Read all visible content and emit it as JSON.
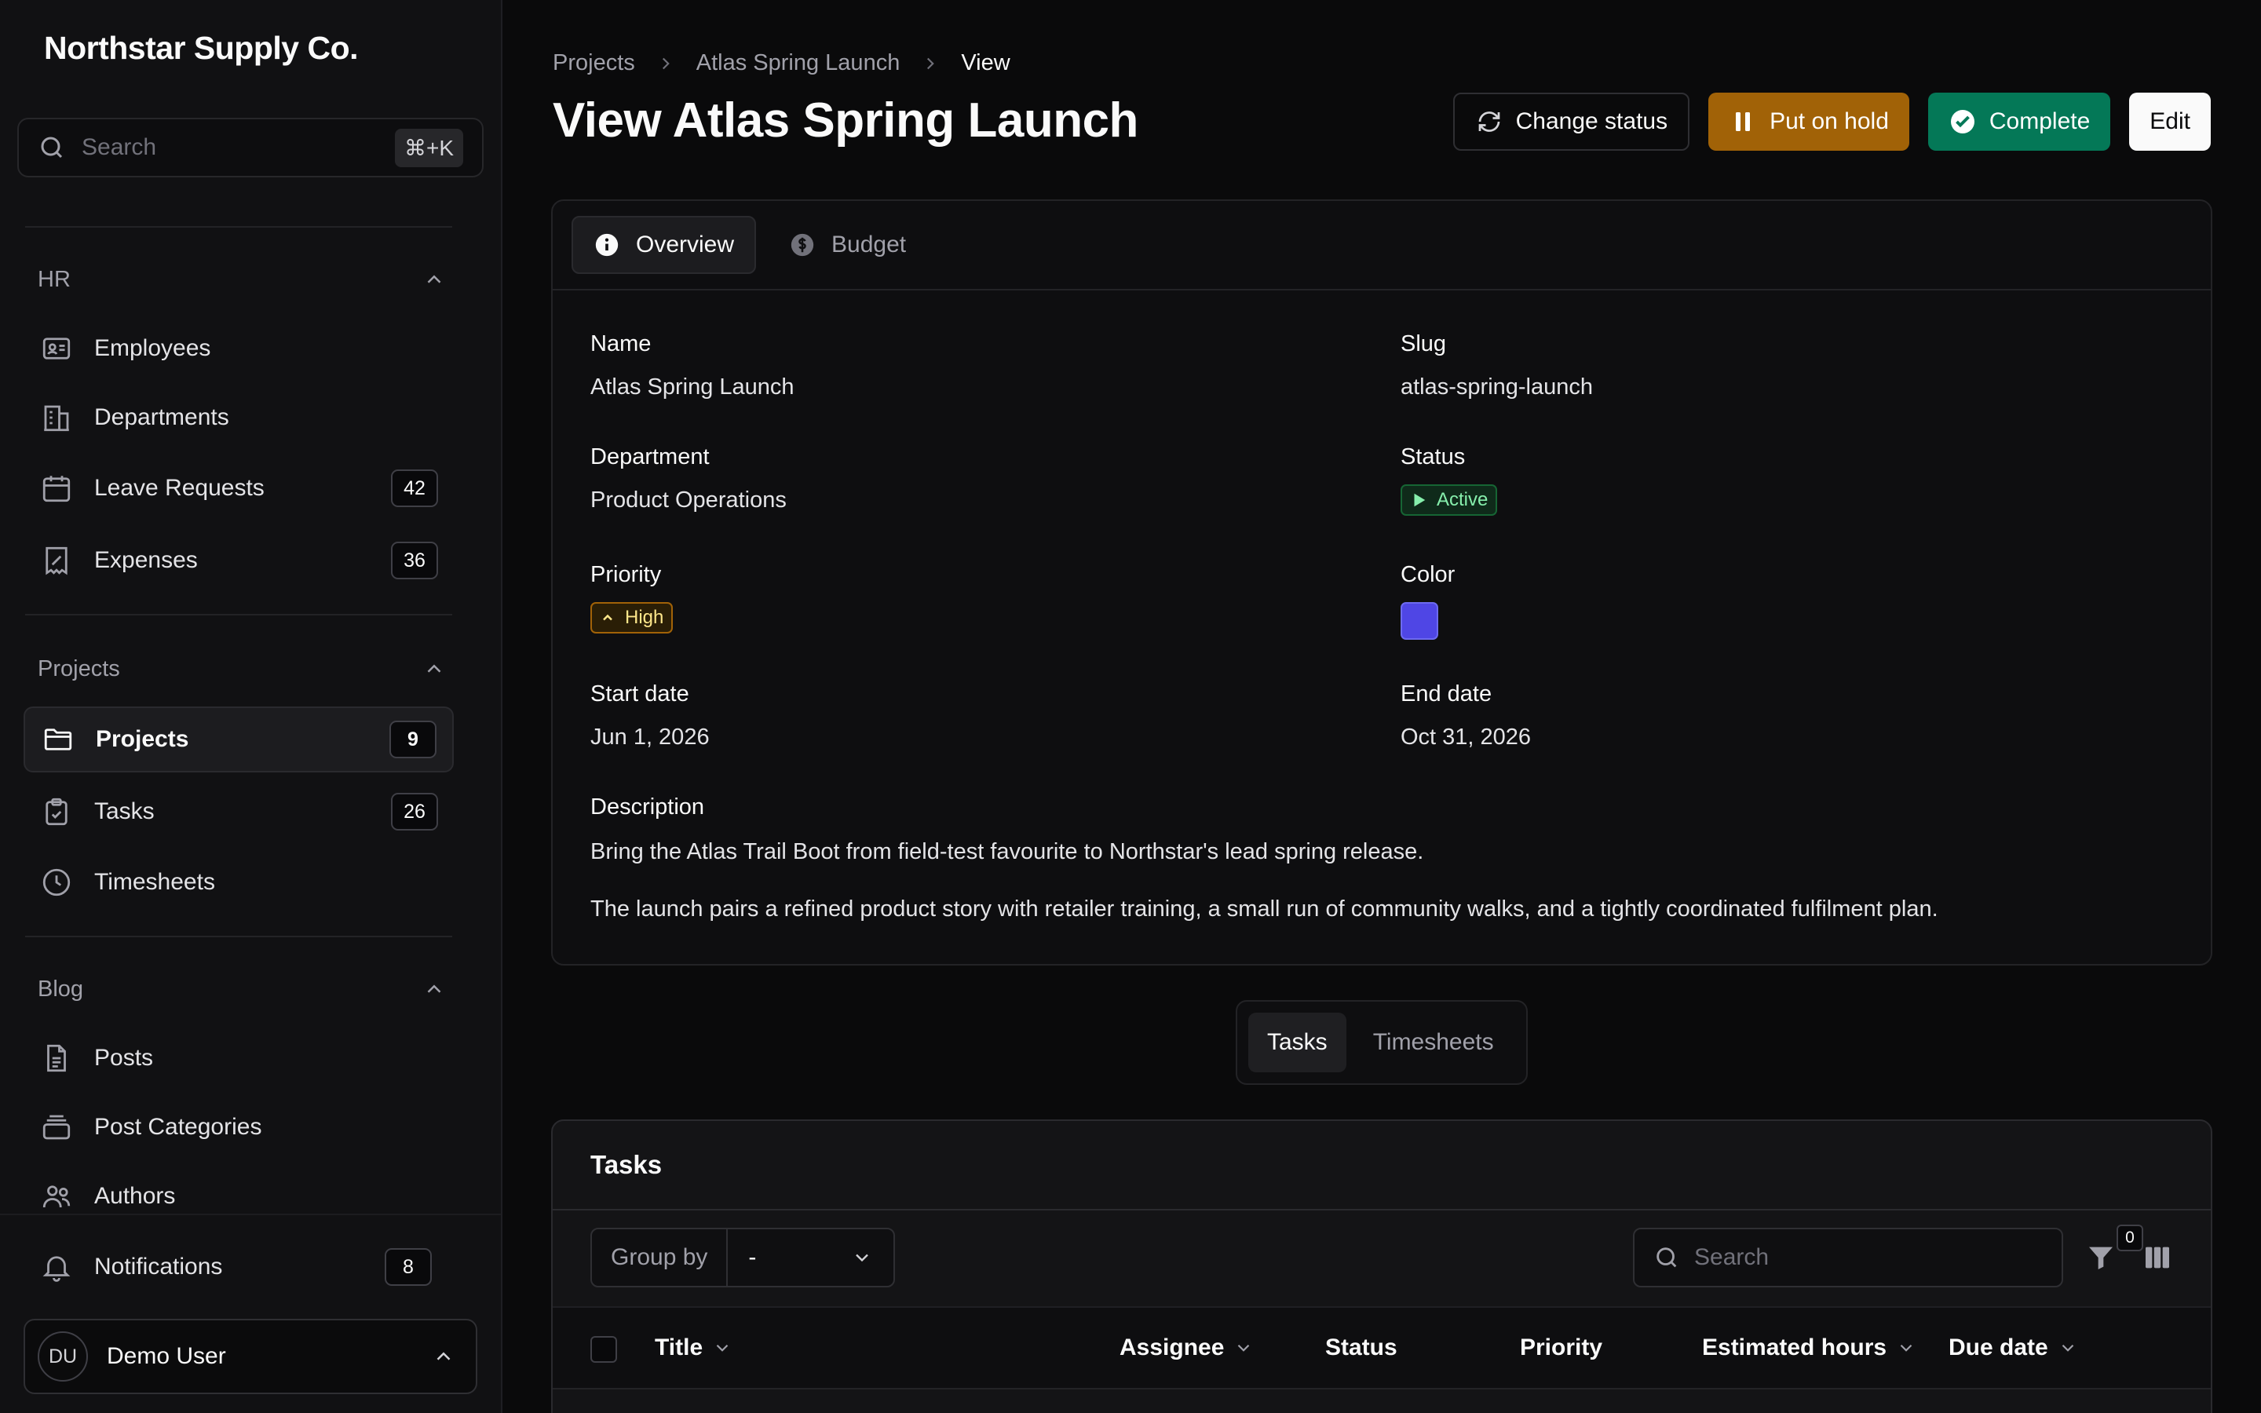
{
  "brand": "Northstar Supply Co.",
  "sidebar": {
    "search_placeholder": "Search",
    "search_shortcut": "⌘+K",
    "groups": [
      {
        "label": "HR",
        "items": [
          {
            "label": "Employees",
            "icon": "id-card-icon",
            "badge": ""
          },
          {
            "label": "Departments",
            "icon": "building-icon",
            "badge": ""
          },
          {
            "label": "Leave Requests",
            "icon": "calendar-icon",
            "badge": "42"
          },
          {
            "label": "Expenses",
            "icon": "receipt-icon",
            "badge": "36"
          }
        ]
      },
      {
        "label": "Projects",
        "items": [
          {
            "label": "Projects",
            "icon": "folder-icon",
            "badge": "9"
          },
          {
            "label": "Tasks",
            "icon": "clipboard-check-icon",
            "badge": "26"
          },
          {
            "label": "Timesheets",
            "icon": "clock-icon",
            "badge": ""
          }
        ]
      },
      {
        "label": "Blog",
        "items": [
          {
            "label": "Posts",
            "icon": "document-icon",
            "badge": ""
          },
          {
            "label": "Post Categories",
            "icon": "stack-icon",
            "badge": ""
          },
          {
            "label": "Authors",
            "icon": "users-icon",
            "badge": ""
          }
        ]
      }
    ],
    "notifications": {
      "label": "Notifications",
      "badge": "8"
    },
    "user": {
      "initials": "DU",
      "name": "Demo User"
    }
  },
  "breadcrumb": [
    "Projects",
    "Atlas Spring Launch",
    "View"
  ],
  "page_title": "View Atlas Spring Launch",
  "actions": {
    "change_status": "Change status",
    "put_on_hold": "Put on hold",
    "complete": "Complete",
    "edit": "Edit"
  },
  "tabs": [
    "Overview",
    "Budget"
  ],
  "fields": {
    "name": {
      "label": "Name",
      "value": "Atlas Spring Launch"
    },
    "slug": {
      "label": "Slug",
      "value": "atlas-spring-launch"
    },
    "department": {
      "label": "Department",
      "value": "Product Operations"
    },
    "status": {
      "label": "Status",
      "value": "Active"
    },
    "priority": {
      "label": "Priority",
      "value": "High"
    },
    "color": {
      "label": "Color",
      "value": "#4f46e5"
    },
    "start_date": {
      "label": "Start date",
      "value": "Jun 1, 2026"
    },
    "end_date": {
      "label": "End date",
      "value": "Oct 31, 2026"
    },
    "description": {
      "label": "Description",
      "paragraphs": [
        "Bring the Atlas Trail Boot from field-test favourite to Northstar's lead spring release.",
        "The launch pairs a refined product story with retailer training, a small run of community walks, and a tightly coordinated fulfilment plan."
      ]
    }
  },
  "relation_tabs": [
    "Tasks",
    "Timesheets"
  ],
  "tasks_table": {
    "heading": "Tasks",
    "group_by_label": "Group by",
    "group_by_value": "-",
    "search_placeholder": "Search",
    "filter_count": "0",
    "columns": [
      "Title",
      "Assignee",
      "Status",
      "Priority",
      "Estimated hours",
      "Due date"
    ]
  }
}
